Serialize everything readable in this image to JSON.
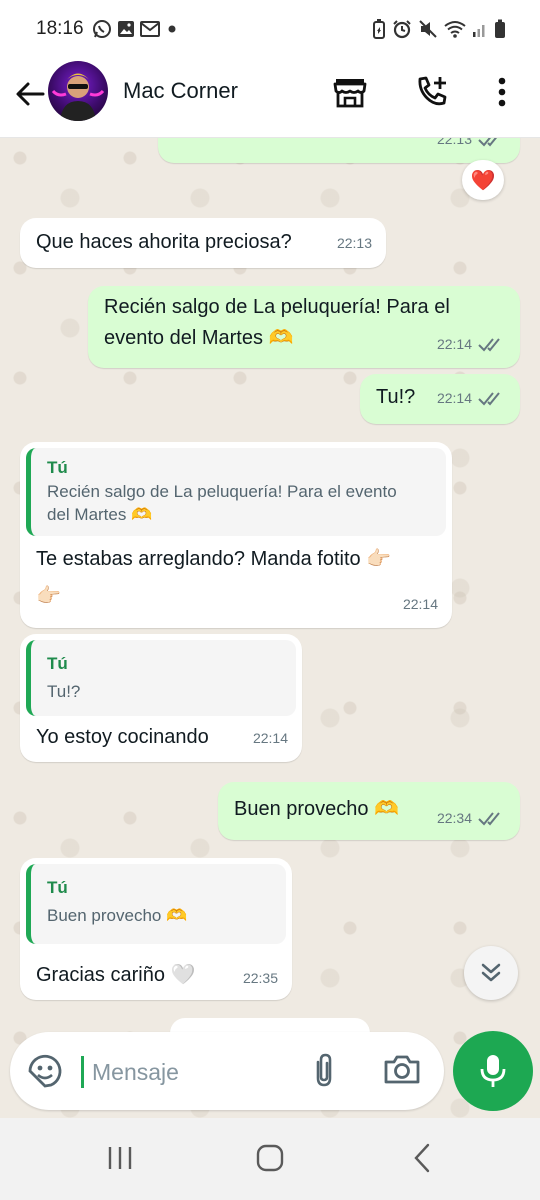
{
  "status_bar": {
    "time": "18:16",
    "left_icons": [
      "whatsapp-icon",
      "gallery-icon",
      "gmail-icon",
      "dot-icon"
    ],
    "right_icons": [
      "battery-saver-icon",
      "alarm-icon",
      "mute-icon",
      "wifi-icon",
      "signal-icon",
      "battery-icon"
    ]
  },
  "header": {
    "contact_name": "Mac Corner",
    "actions": [
      "store-icon",
      "add-call-icon",
      "more-vert-icon"
    ]
  },
  "messages": [
    {
      "id": "m0",
      "direction": "out",
      "text": "",
      "time": "22:13",
      "status": "read",
      "reaction": "❤️"
    },
    {
      "id": "m1",
      "direction": "in",
      "text": "Que haces ahorita preciosa?",
      "time": "22:13"
    },
    {
      "id": "m2",
      "direction": "out",
      "text": "Recién salgo de La peluquería! Para el evento del Martes 🫶",
      "line1": "Recién salgo de La peluquería! Para el",
      "line2": "evento del Martes 🫶",
      "time": "22:14",
      "status": "read"
    },
    {
      "id": "m3",
      "direction": "out",
      "text": "Tu!?",
      "time": "22:14",
      "status": "read"
    },
    {
      "id": "m4",
      "direction": "in",
      "quote_author": "Tú",
      "quote_text_line1": "Recién salgo de La peluquería! Para el evento",
      "quote_text_line2": "del Martes 🫶",
      "line1": "Te estabas arreglando? Manda fotito 👉🏻",
      "line2": "👉🏻",
      "time": "22:14"
    },
    {
      "id": "m5",
      "direction": "in",
      "quote_author": "Tú",
      "quote_text": "Tu!?",
      "text": "Yo estoy cocinando",
      "time": "22:14"
    },
    {
      "id": "m6",
      "direction": "out",
      "text": "Buen provecho 🫶",
      "time": "22:34",
      "status": "read"
    },
    {
      "id": "m7",
      "direction": "in",
      "quote_author": "Tú",
      "quote_text": "Buen provecho 🫶",
      "text": "Gracias cariño 🤍",
      "time": "22:35"
    }
  ],
  "composer": {
    "placeholder": "Mensaje",
    "icons": [
      "sticker-icon",
      "attach-icon",
      "camera-icon",
      "mic-icon"
    ]
  },
  "nav_bar": {
    "buttons": [
      "recents-icon",
      "home-icon",
      "back-icon"
    ]
  },
  "colors": {
    "accent": "#1da852",
    "outgoing_bubble": "#d9fdd3",
    "incoming_bubble": "#ffffff",
    "quote_bar": "#1fa855",
    "chat_background": "#efeae2"
  }
}
